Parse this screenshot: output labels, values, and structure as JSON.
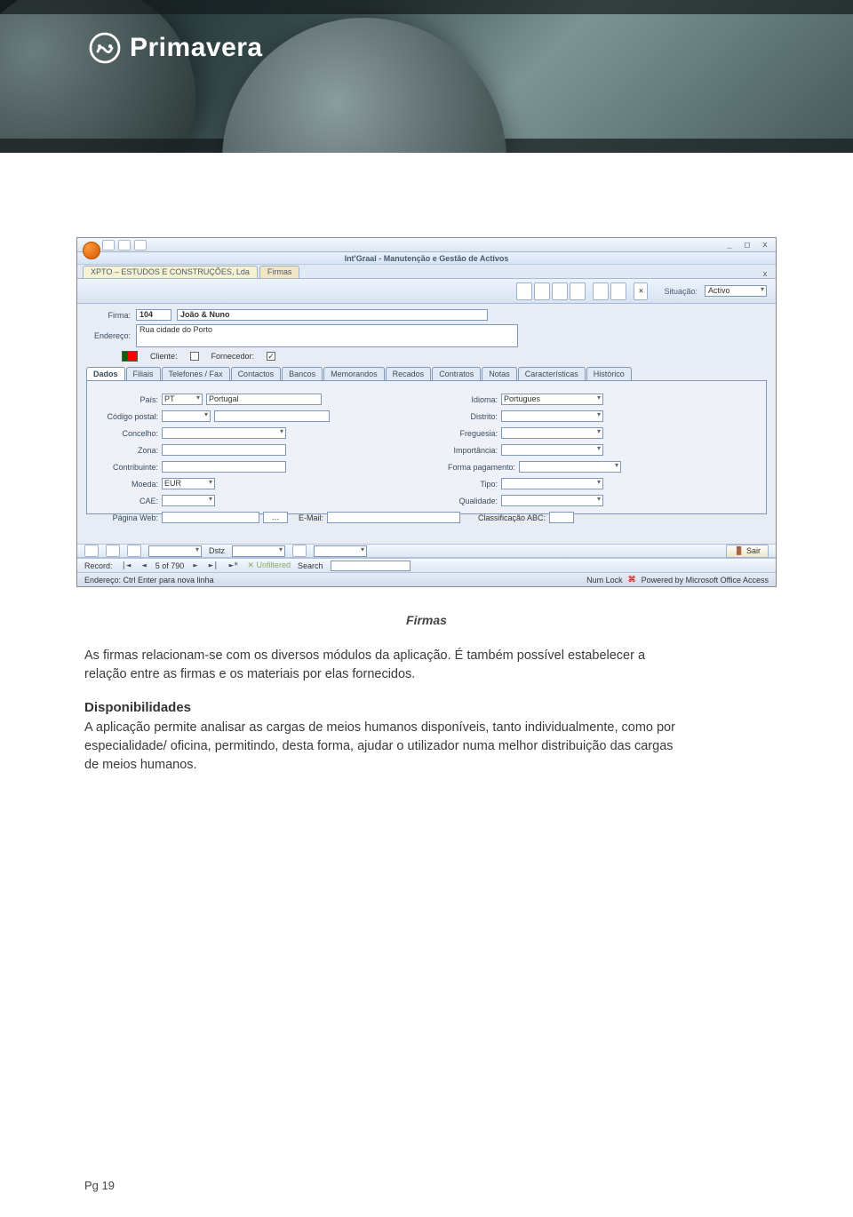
{
  "brand": {
    "name": "Primavera"
  },
  "screenshot": {
    "app_title": "Int'Graal - Manutenção e Gestão de Activos",
    "doc_tab_main": "XPTO – ESTUDOS E CONSTRUÇÕES, Lda",
    "doc_tab_sub": "Firmas",
    "situacao_label": "Situação:",
    "situacao_value": "Activo",
    "labels": {
      "firma": "Firma:",
      "endereco": "Endereço:",
      "cliente": "Cliente:",
      "fornecedor": "Fornecedor:"
    },
    "firma_code": "104",
    "firma_name": "João & Nuno",
    "endereco_value": "Rua cidade do Porto",
    "fornecedor_checked": "✓",
    "tabs": [
      "Dados",
      "Filiais",
      "Telefones / Fax",
      "Contactos",
      "Bancos",
      "Memorandos",
      "Recados",
      "Contratos",
      "Notas",
      "Características",
      "Histórico"
    ],
    "fields": {
      "pais_lbl": "País:",
      "pais_code": "PT",
      "pais_name": "Portugal",
      "idioma_lbl": "Idioma:",
      "idioma_val": "Portugues",
      "codpostal_lbl": "Código postal:",
      "distrito_lbl": "Distrito:",
      "concelho_lbl": "Concelho:",
      "freguesia_lbl": "Freguesia:",
      "zona_lbl": "Zona:",
      "importancia_lbl": "Importância:",
      "contribuinte_lbl": "Contribuinte:",
      "formapag_lbl": "Forma pagamento:",
      "moeda_lbl": "Moeda:",
      "moeda_val": "EUR",
      "tipo_lbl": "Tipo:",
      "cae_lbl": "CAE:",
      "qualidade_lbl": "Qualidade:",
      "pagweb_lbl": "Página Web:",
      "email_lbl": "E-Mail:",
      "classabc_lbl": "Classificação ABC:"
    },
    "recordbar": {
      "record_lbl": "Record:",
      "nav_first": "|◄",
      "nav_prev": "◄",
      "pos": "5 of 790",
      "nav_next": "►",
      "nav_last": "►|",
      "new": "►*",
      "unfiltered": "Unfiltered",
      "search": "Search",
      "dstz": "Dstz"
    },
    "sair": "Sair",
    "statusbar": {
      "hint": "Endereço: Ctrl Enter para nova linha",
      "numlock": "Num Lock",
      "powered": "Powered by Microsoft Office Access"
    }
  },
  "text": {
    "caption": "Firmas",
    "para1": "As firmas relacionam-se com os diversos módulos da aplicação. É também possível estabelecer a relação entre as firmas e os materiais por elas fornecidos.",
    "subhead": "Disponibilidades",
    "para2": "A aplicação permite analisar as cargas de meios humanos disponíveis, tanto individualmente, como por especialidade/ oficina, permitindo, desta forma, ajudar o utilizador numa melhor distribuição das cargas de meios humanos."
  },
  "page_number": "Pg 19"
}
